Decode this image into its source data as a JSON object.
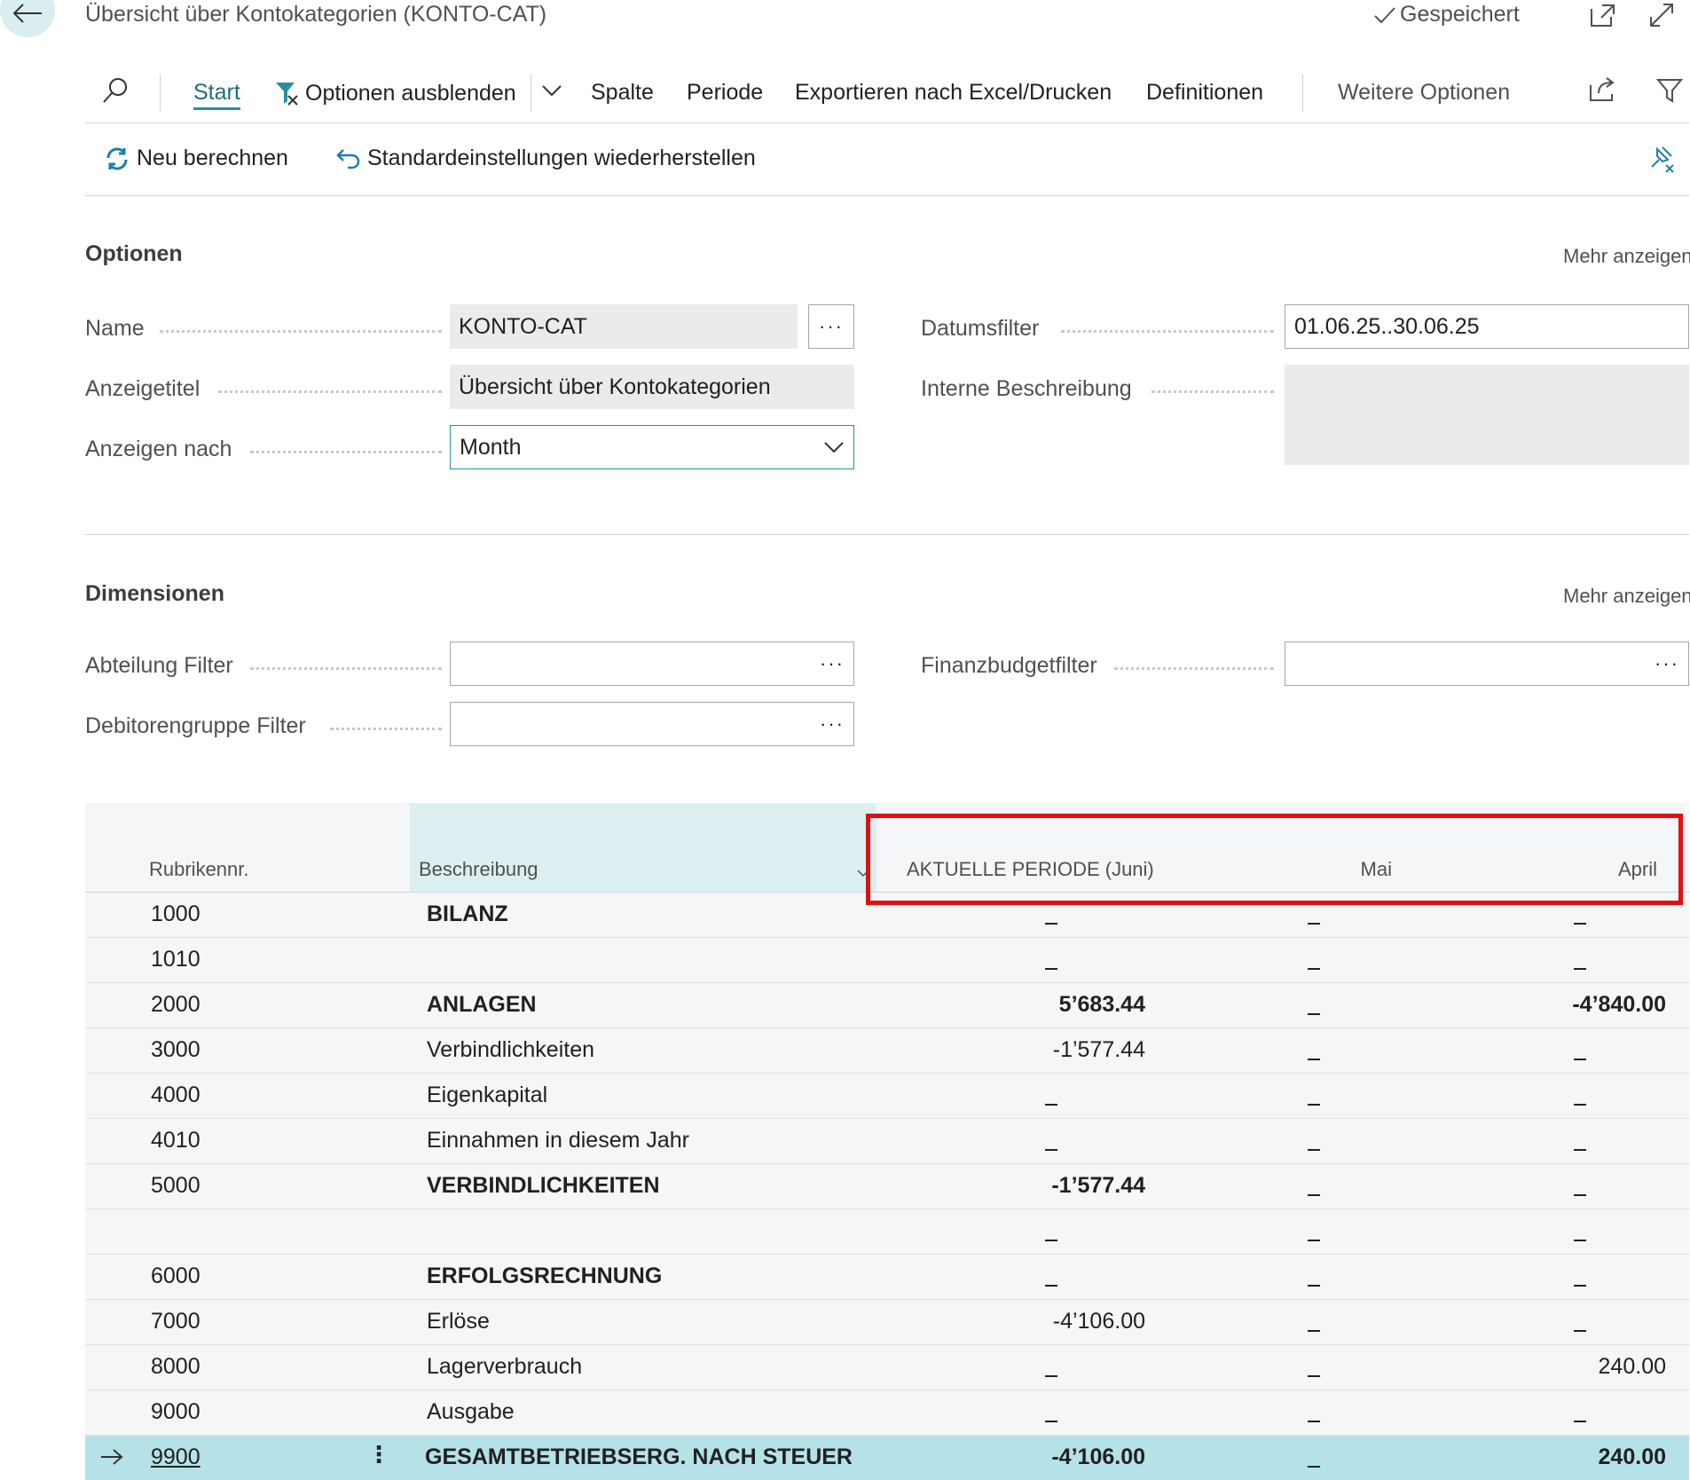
{
  "header": {
    "title": "Übersicht über Kontokategorien (KONTO-CAT)",
    "saved_label": "Gespeichert"
  },
  "toolbar": {
    "start": "Start",
    "hide_options": "Optionen ausblenden",
    "column": "Spalte",
    "period": "Periode",
    "export": "Exportieren nach Excel/Drucken",
    "definitions": "Definitionen",
    "more_options": "Weitere Optionen"
  },
  "subbar": {
    "recalculate": "Neu berechnen",
    "restore_defaults": "Standardeinstellungen wiederherstellen"
  },
  "options": {
    "title": "Optionen",
    "more": "Mehr anzeigen",
    "name_label": "Name",
    "name_value": "KONTO-CAT",
    "display_title_label": "Anzeigetitel",
    "display_title_value": "Übersicht über Kontokategorien",
    "show_by_label": "Anzeigen nach",
    "show_by_value": "Month",
    "date_filter_label": "Datumsfilter",
    "date_filter_value": "01.06.25..30.06.25",
    "internal_desc_label": "Interne Beschreibung",
    "internal_desc_value": ""
  },
  "dimensions": {
    "title": "Dimensionen",
    "more": "Mehr anzeigen",
    "dept_filter_label": "Abteilung Filter",
    "dept_filter_value": "",
    "cust_group_filter_label": "Debitorengruppe Filter",
    "cust_group_filter_value": "",
    "budget_filter_label": "Finanzbudgetfilter",
    "budget_filter_value": ""
  },
  "table": {
    "columns": {
      "nr": "Rubrikennr.",
      "desc": "Beschreibung",
      "current": "AKTUELLE PERIODE (Juni)",
      "may": "Mai",
      "april": "April"
    },
    "rows": [
      {
        "nr": "1000",
        "desc": "BILANZ",
        "bold": true,
        "current": "",
        "may": "",
        "april": ""
      },
      {
        "nr": "1010",
        "desc": "",
        "bold": false,
        "current": "",
        "may": "",
        "april": ""
      },
      {
        "nr": "2000",
        "desc": "ANLAGEN",
        "bold": true,
        "current": "5’683.44",
        "may": "",
        "april": "-4’840.00"
      },
      {
        "nr": "3000",
        "desc": "Verbindlichkeiten",
        "bold": false,
        "current": "-1’577.44",
        "may": "",
        "april": ""
      },
      {
        "nr": "4000",
        "desc": "Eigenkapital",
        "bold": false,
        "current": "",
        "may": "",
        "april": ""
      },
      {
        "nr": "4010",
        "desc": "Einnahmen in diesem Jahr",
        "bold": false,
        "current": "",
        "may": "",
        "april": ""
      },
      {
        "nr": "5000",
        "desc": "VERBINDLICHKEITEN",
        "bold": true,
        "current": "-1’577.44",
        "may": "",
        "april": ""
      },
      {
        "nr": "",
        "desc": "",
        "bold": false,
        "current": "",
        "may": "",
        "april": ""
      },
      {
        "nr": "6000",
        "desc": "ERFOLGSRECHNUNG",
        "bold": true,
        "current": "",
        "may": "",
        "april": ""
      },
      {
        "nr": "7000",
        "desc": "Erlöse",
        "bold": false,
        "current": "-4’106.00",
        "may": "",
        "april": ""
      },
      {
        "nr": "8000",
        "desc": "Lagerverbrauch",
        "bold": false,
        "current": "",
        "may": "",
        "april": "240.00"
      },
      {
        "nr": "9000",
        "desc": "Ausgabe",
        "bold": false,
        "current": "",
        "may": "",
        "april": ""
      },
      {
        "nr": "9900",
        "desc": "GESAMTBETRIEBSERG. NACH STEUER",
        "bold": true,
        "selected": true,
        "current": "-4’106.00",
        "may": "",
        "april": "240.00"
      }
    ]
  },
  "colors": {
    "accent": "#2a8f9b",
    "selected_row": "#b4e2e8",
    "highlight_box": "#e01010"
  }
}
